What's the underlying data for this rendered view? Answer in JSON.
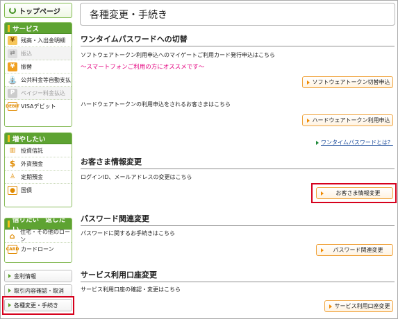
{
  "sidebar": {
    "top_label": "トップページ",
    "services": {
      "title": "サービス",
      "items": [
        {
          "label": "残高・入出金明細",
          "icon": "coins-icon",
          "disabled": false
        },
        {
          "label": "振込",
          "icon": "transfer-icon",
          "disabled": true
        },
        {
          "label": "振替",
          "icon": "exchange-icon",
          "disabled": false
        },
        {
          "label": "公共料金等自動支払",
          "icon": "faucet-icon",
          "disabled": false
        },
        {
          "label": "ペイジー料金払込",
          "icon": "payeasy-icon",
          "disabled": true
        },
        {
          "label": "VISAデビット",
          "icon": "card-icon",
          "disabled": false
        }
      ]
    },
    "increase": {
      "title": "増やしたい",
      "items": [
        {
          "label": "投資信託",
          "icon": "chart-icon"
        },
        {
          "label": "外貨預金",
          "icon": "dollar-icon"
        },
        {
          "label": "定期預金",
          "icon": "savings-icon"
        },
        {
          "label": "国債",
          "icon": "bond-icon"
        }
      ]
    },
    "borrow": {
      "title": "借りたい　返したい",
      "items": [
        {
          "label": "住宅・その他のローン",
          "icon": "house-icon"
        },
        {
          "label": "カードローン",
          "icon": "loan-card-icon"
        }
      ]
    },
    "links": [
      "金利情報",
      "取引内容確認・取消",
      "各種変更・手続き"
    ]
  },
  "main": {
    "title": "各種変更・手続き",
    "otp": {
      "heading": "ワンタイムパスワードへの切替",
      "desc1": "ソフトウェアトークン利用申込へのマイゲートご利用カード発行申込はこちら",
      "promo": "～スマートフォンご利用の方にオススメです～",
      "btn1": "ソフトウェアトークン切替申込",
      "desc2": "ハードウェアトークンの利用申込をされるお客さまはこちら",
      "btn2": "ハードウェアトークン利用申込",
      "help": "ワンタイムパスワードとは？"
    },
    "customer": {
      "heading": "お客さま情報変更",
      "desc": "ログインID、メールアドレスの変更はこちら",
      "btn": "お客さま情報変更"
    },
    "password": {
      "heading": "パスワード関連変更",
      "desc": "パスワードに関するお手続きはこちら",
      "btn": "パスワード関連変更"
    },
    "account": {
      "heading": "サービス利用口座変更",
      "desc": "サービス利用口座の確認・変更はこちら",
      "btn": "サービス利用口座変更"
    }
  },
  "colors": {
    "accent_green": "#5ea332",
    "highlight_red": "#d6001c",
    "promo_pink": "#e4007f",
    "button_orange": "#f0a33b",
    "link_blue": "#1a4b9b"
  }
}
